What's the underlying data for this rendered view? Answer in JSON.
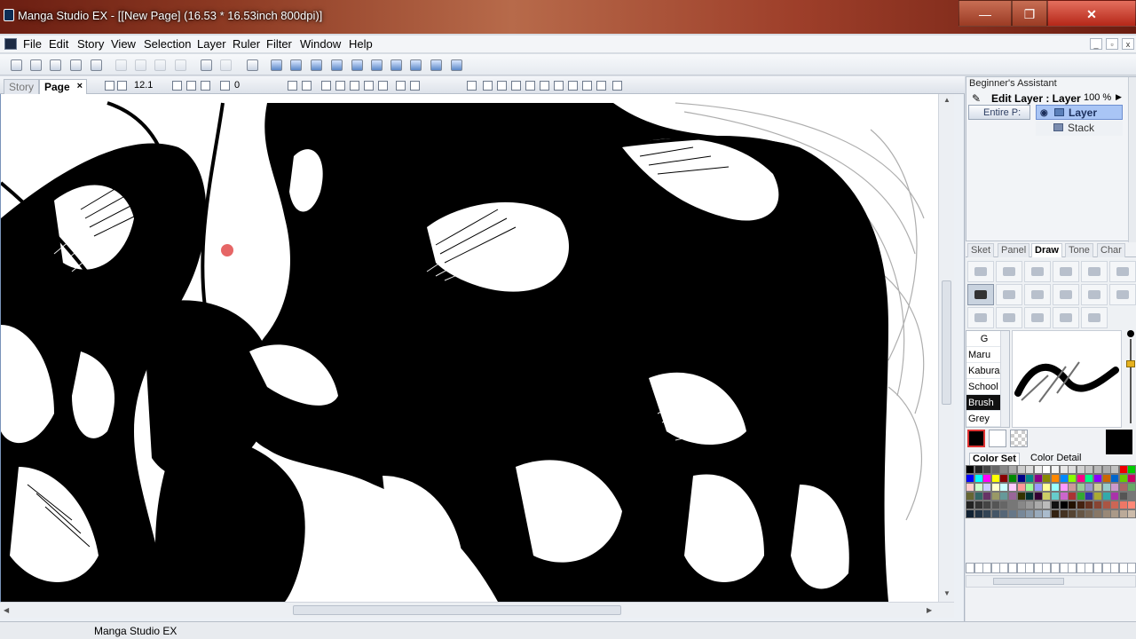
{
  "window": {
    "title": "Manga Studio EX - [[New Page] (16.53 * 16.53inch 800dpi)]",
    "minimize_glyph": "—",
    "maximize_glyph": "❐",
    "close_glyph": "✕"
  },
  "menu": {
    "items": [
      "File",
      "Edit",
      "Story",
      "View",
      "Selection",
      "Layer",
      "Ruler",
      "Filter",
      "Window",
      "Help"
    ]
  },
  "document": {
    "tabs": {
      "story": "Story",
      "page": "Page",
      "close": "×"
    },
    "zoom": "12.1",
    "rotation": "0"
  },
  "right_panel": {
    "assistant_title": "Beginner's Assistant",
    "edit_layer_label": "Edit Layer : Layer",
    "opacity": "100 %",
    "entire_button": "Entire P:",
    "layers": [
      {
        "name": "Layer",
        "selected": true
      },
      {
        "name": "Stack",
        "selected": false
      }
    ],
    "tool_tabs": [
      "Sket",
      "Panel",
      "Draw",
      "Tone",
      "Char"
    ],
    "active_tool_tab": "Draw",
    "presets": [
      "G",
      "Maru",
      "Kabura",
      "School",
      "Brush",
      "Grey"
    ],
    "active_preset": "Brush",
    "color_tabs": [
      "Color Set",
      "Color Detail"
    ],
    "active_color_tab": "Color Set",
    "main_color": "#000000",
    "sub_color": "#ffffff"
  },
  "status": {
    "text": "Manga Studio EX"
  }
}
